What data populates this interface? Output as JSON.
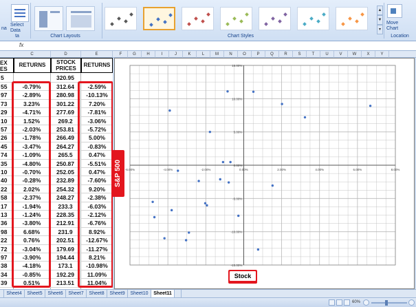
{
  "ribbon": {
    "partial_label": "na",
    "select_data_label": "Select Data",
    "data_group_label": "ta",
    "chart_layouts_label": "Chart Layouts",
    "chart_styles_label": "Chart Styles",
    "move_chart_label": "Move Chart",
    "location_label": "Location",
    "style_colors": [
      "#595959",
      "#4472c4",
      "#c0504d",
      "#9bbb59",
      "#8064a2",
      "#4bacc6",
      "#f79646"
    ]
  },
  "formula_bar": {
    "fx_label": "fx",
    "value": ""
  },
  "columns": [
    "C",
    "D",
    "E",
    "F",
    "G",
    "H",
    "I",
    "J",
    "K",
    "L",
    "M",
    "N",
    "O",
    "P",
    "Q",
    "R",
    "S",
    "T",
    "U",
    "V",
    "W",
    "X",
    "Y"
  ],
  "table": {
    "header_a": "EX\nES",
    "header_returns1": "RETURNS",
    "header_stock": "STOCK\nPRICES",
    "header_returns2": "RETURNS",
    "first_row": {
      "a": "5",
      "d": "320.95"
    },
    "rows": [
      {
        "a": "55",
        "c": "-0.79%",
        "d": "312.64",
        "e": "-2.59%"
      },
      {
        "a": "97",
        "c": "-2.89%",
        "d": "280.98",
        "e": "-10.13%"
      },
      {
        "a": "73",
        "c": "3.23%",
        "d": "301.22",
        "e": "7.20%"
      },
      {
        "a": "29",
        "c": "-4.71%",
        "d": "277.69",
        "e": "-7.81%"
      },
      {
        "a": "10",
        "c": "1.52%",
        "d": "269.2",
        "e": "-3.06%"
      },
      {
        "a": "57",
        "c": "-2.03%",
        "d": "253.81",
        "e": "-5.72%"
      },
      {
        "a": "26",
        "c": "-1.78%",
        "d": "266.49",
        "e": "5.00%"
      },
      {
        "a": "45",
        "c": "-3.47%",
        "d": "264.27",
        "e": "-0.83%"
      },
      {
        "a": "74",
        "c": "-1.09%",
        "d": "265.5",
        "e": "0.47%"
      },
      {
        "a": "35",
        "c": "-4.80%",
        "d": "250.87",
        "e": "-5.51%"
      },
      {
        "a": "10",
        "c": "-0.70%",
        "d": "252.05",
        "e": "0.47%"
      },
      {
        "a": "40",
        "c": "-0.28%",
        "d": "232.89",
        "e": "-7.60%"
      },
      {
        "a": "22",
        "c": "2.02%",
        "d": "254.32",
        "e": "9.20%"
      },
      {
        "a": "58",
        "c": "-2.37%",
        "d": "248.27",
        "e": "-2.38%"
      },
      {
        "a": "17",
        "c": "-1.94%",
        "d": "233.3",
        "e": "-6.03%"
      },
      {
        "a": "13",
        "c": "-1.24%",
        "d": "228.35",
        "e": "-2.12%"
      },
      {
        "a": "36",
        "c": "-3.80%",
        "d": "212.91",
        "e": "-6.76%"
      },
      {
        "a": "98",
        "c": "6.68%",
        "d": "231.9",
        "e": "8.92%"
      },
      {
        "a": "22",
        "c": "0.76%",
        "d": "202.51",
        "e": "-12.67%"
      },
      {
        "a": "72",
        "c": "-3.04%",
        "d": "179.69",
        "e": "-11.27%"
      },
      {
        "a": "97",
        "c": "-3.90%",
        "d": "194.44",
        "e": "8.21%"
      },
      {
        "a": "38",
        "c": "-4.18%",
        "d": "173.1",
        "e": "-10.98%"
      },
      {
        "a": "34",
        "c": "-0.85%",
        "d": "192.29",
        "e": "11.09%"
      },
      {
        "a": "39",
        "c": "0.51%",
        "d": "213.51",
        "e": "11.04%"
      }
    ]
  },
  "callouts": {
    "sp500": "S&P 500",
    "stock": "Stock"
  },
  "chart_data": {
    "type": "scatter",
    "title": "",
    "xlabel": "",
    "ylabel": "",
    "xlim": [
      -6,
      8
    ],
    "ylim": [
      -15,
      15
    ],
    "x_ticks": [
      "-6.00%",
      "-4.00%",
      "-2.00%",
      "0.00%",
      "2.00%",
      "4.00%",
      "6.00%",
      "8.00%"
    ],
    "y_ticks": [
      "15.00%",
      "10.00%",
      "5.00%",
      "0.00%",
      "-5.00%",
      "-10.00%",
      "-15.00%"
    ],
    "x_tick_values": [
      -6,
      -4,
      -2,
      0,
      2,
      4,
      6,
      8
    ],
    "y_tick_values": [
      15,
      10,
      5,
      0,
      -5,
      -10,
      -15
    ],
    "grid": true,
    "legend": "none",
    "marker_color": "#4472c4",
    "series": [
      {
        "x": [
          -0.79,
          -2.89,
          3.23,
          -4.71,
          1.52,
          -2.03,
          -1.78,
          -3.47,
          -1.09,
          -4.8,
          -0.7,
          -0.28,
          2.02,
          -2.37,
          -1.94,
          -1.24,
          -3.8,
          6.68,
          0.76,
          -3.04,
          -3.9,
          -4.18,
          -0.85,
          0.51
        ],
        "y": [
          -2.59,
          -10.13,
          7.2,
          -7.81,
          -3.06,
          -5.72,
          5.0,
          -0.83,
          0.47,
          -5.51,
          0.47,
          -7.6,
          9.2,
          -2.38,
          -6.03,
          -2.12,
          -6.76,
          8.92,
          -12.67,
          -11.27,
          8.21,
          -10.98,
          11.09,
          11.04
        ]
      }
    ]
  },
  "sheet_tabs": [
    "Sheet4",
    "Sheet5",
    "Sheet6",
    "Sheet7",
    "Sheet8",
    "Sheet9",
    "Sheet10",
    "Sheet11"
  ],
  "active_tab": "Sheet11",
  "status": {
    "zoom": "60%"
  }
}
